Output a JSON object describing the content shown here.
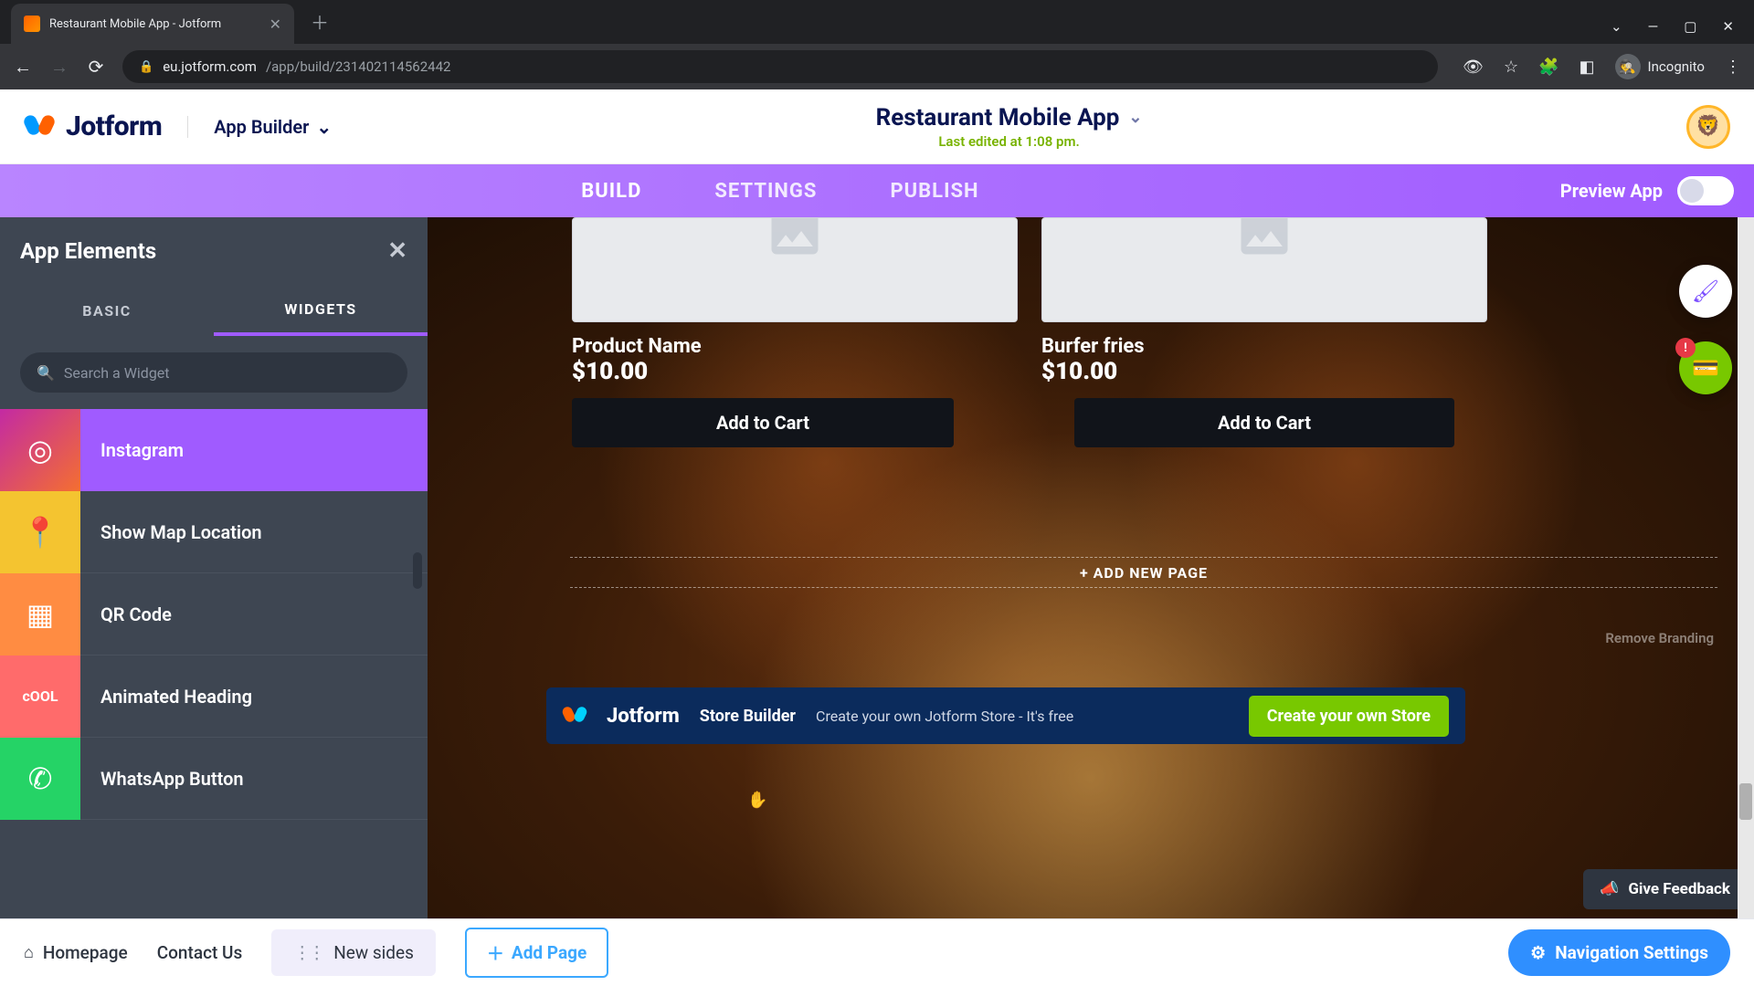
{
  "browser": {
    "tab_title": "Restaurant Mobile App - Jotform",
    "url_host": "eu.jotform.com",
    "url_path": "/app/build/231402114562442",
    "incognito_label": "Incognito"
  },
  "header": {
    "brand": "Jotform",
    "app_builder_label": "App Builder",
    "title": "Restaurant Mobile App",
    "last_edited": "Last edited at 1:08 pm."
  },
  "main_tabs": {
    "build": "BUILD",
    "settings": "SETTINGS",
    "publish": "PUBLISH",
    "preview_label": "Preview App"
  },
  "sidebar": {
    "title": "App Elements",
    "tab_basic": "BASIC",
    "tab_widgets": "WIDGETS",
    "search_placeholder": "Search a Widget",
    "items": [
      {
        "label": "Instagram"
      },
      {
        "label": "Show Map Location"
      },
      {
        "label": "QR Code"
      },
      {
        "label": "Animated Heading"
      },
      {
        "label": "WhatsApp Button"
      }
    ]
  },
  "cards": [
    {
      "name": "Product Name",
      "price": "$10.00",
      "cta": "Add to Cart"
    },
    {
      "name": "Burfer fries",
      "price": "$10.00",
      "cta": "Add to Cart"
    }
  ],
  "canvas": {
    "add_new_page": "+ ADD NEW PAGE",
    "remove_branding": "Remove Branding"
  },
  "promo": {
    "brand": "Jotform",
    "sub": "Store Builder",
    "desc": "Create your own Jotform Store - It's free",
    "cta": "Create your own Store"
  },
  "float": {
    "badge": "!"
  },
  "feedback": {
    "label": "Give Feedback"
  },
  "bottom": {
    "homepage": "Homepage",
    "contact": "Contact Us",
    "page_chip": "New sides",
    "add_page": "Add Page",
    "nav_settings": "Navigation Settings"
  }
}
